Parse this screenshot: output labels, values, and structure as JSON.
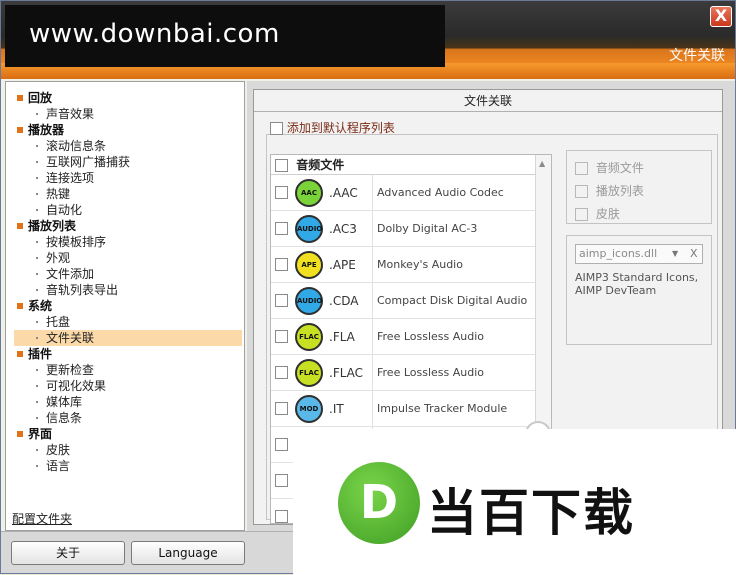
{
  "watermark": {
    "site": "www.downbai.com",
    "logo_letter": "D",
    "logo_text": "当百下载"
  },
  "window": {
    "header_title": "文件关联",
    "close_label": "X"
  },
  "sidebar": {
    "tree": [
      {
        "type": "cat",
        "label": "回放"
      },
      {
        "type": "item",
        "label": "声音效果"
      },
      {
        "type": "cat",
        "label": "播放器"
      },
      {
        "type": "item",
        "label": "滚动信息条"
      },
      {
        "type": "item",
        "label": "互联网广播捕获"
      },
      {
        "type": "item",
        "label": "连接选项"
      },
      {
        "type": "item",
        "label": "热键"
      },
      {
        "type": "item",
        "label": "自动化"
      },
      {
        "type": "cat",
        "label": "播放列表"
      },
      {
        "type": "item",
        "label": "按模板排序"
      },
      {
        "type": "item",
        "label": "外观"
      },
      {
        "type": "item",
        "label": "文件添加"
      },
      {
        "type": "item",
        "label": "音轨列表导出"
      },
      {
        "type": "cat",
        "label": "系统"
      },
      {
        "type": "item",
        "label": "托盘"
      },
      {
        "type": "item",
        "label": "文件关联",
        "selected": true
      },
      {
        "type": "cat",
        "label": "插件"
      },
      {
        "type": "item",
        "label": "更新检查"
      },
      {
        "type": "item",
        "label": "可视化效果"
      },
      {
        "type": "item",
        "label": "媒体库"
      },
      {
        "type": "item",
        "label": "信息条"
      },
      {
        "type": "cat",
        "label": "界面"
      },
      {
        "type": "item",
        "label": "皮肤"
      },
      {
        "type": "item",
        "label": "语言"
      }
    ],
    "config_link": "配置文件夹"
  },
  "footer": {
    "about_label": "关于",
    "language_label": "Language"
  },
  "panel": {
    "title": "文件关联",
    "default_program_label": "添加到默认程序列表",
    "list_header": "音频文件",
    "rows": [
      {
        "badge": "AAC",
        "ext": ".AAC",
        "desc": "Advanced Audio Codec",
        "color": "#7bd33a"
      },
      {
        "badge": "AUDIO",
        "ext": ".AC3",
        "desc": "Dolby Digital AC-3",
        "color": "#31a9e6"
      },
      {
        "badge": "APE",
        "ext": ".APE",
        "desc": "Monkey's Audio",
        "color": "#f0e020"
      },
      {
        "badge": "AUDIO",
        "ext": ".CDA",
        "desc": "Compact Disk Digital Audio",
        "color": "#31a9e6"
      },
      {
        "badge": "FLAC",
        "ext": ".FLA",
        "desc": "Free Lossless Audio",
        "color": "#c8e024"
      },
      {
        "badge": "FLAC",
        "ext": ".FLAC",
        "desc": "Free Lossless Audio",
        "color": "#c8e024"
      },
      {
        "badge": "MOD",
        "ext": ".IT",
        "desc": "Impulse Tracker Module",
        "color": "#5ab8e8"
      },
      {
        "badge": "",
        "ext": "",
        "desc": "",
        "color": "#5ab8e8"
      },
      {
        "badge": "",
        "ext": "",
        "desc": "",
        "color": "#ffffff"
      },
      {
        "badge": "",
        "ext": "",
        "desc": "",
        "color": "#ffffff"
      }
    ],
    "options": {
      "audio": "音频文件",
      "playlist": "播放列表",
      "skin": "皮肤"
    },
    "icons": {
      "selected_file": "aimp_icons.dll",
      "dropdown_glyph": "▼",
      "clear_glyph": "X",
      "info": "AIMP3 Standard Icons, AIMP DevTeam"
    }
  }
}
